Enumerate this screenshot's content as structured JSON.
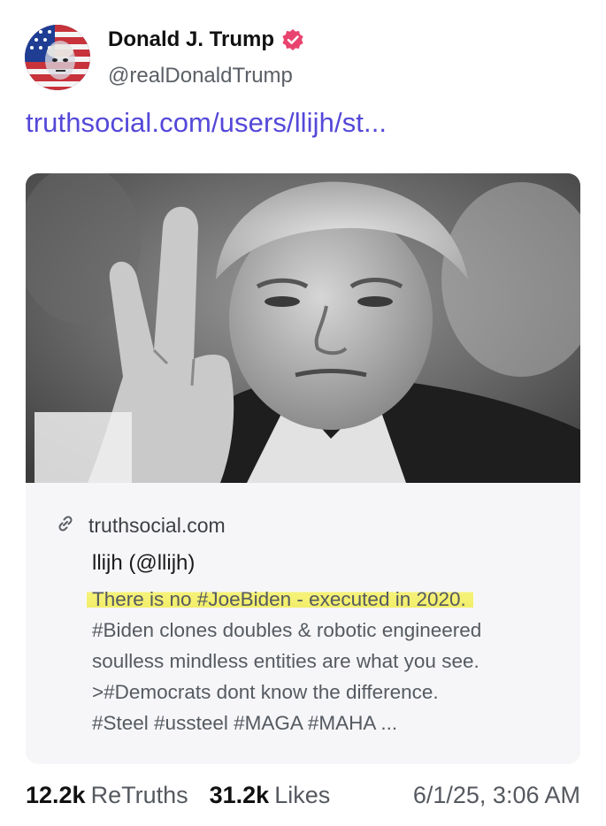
{
  "author": {
    "name": "Donald J. Trump",
    "handle": "@realDonaldTrump",
    "avatar_icon": "flag-portrait-avatar",
    "verified_icon": "verified-badge-icon",
    "verified_color": "#e8436e"
  },
  "post": {
    "link_text": "truthsocial.com/users/llijh/st...",
    "link_color": "#5448d8"
  },
  "card": {
    "image_desc_icon": "black-and-white-photo",
    "link_icon": "link-chain-icon",
    "domain": "truthsocial.com",
    "title": "llijh (@llijh)",
    "description_lines": [
      "There is no #JoeBiden - executed in 2020.",
      "#Biden clones doubles & robotic engineered",
      "soulless mindless entities are what you see.",
      ">#Democrats dont know the difference.",
      "#Steel #ussteel #MAGA #MAHA ..."
    ],
    "highlight_color": "#f4f06e"
  },
  "stats": {
    "retruths_count": "12.2k",
    "retruths_label": "ReTruths",
    "likes_count": "31.2k",
    "likes_label": "Likes",
    "timestamp": "6/1/25, 3:06 AM"
  }
}
